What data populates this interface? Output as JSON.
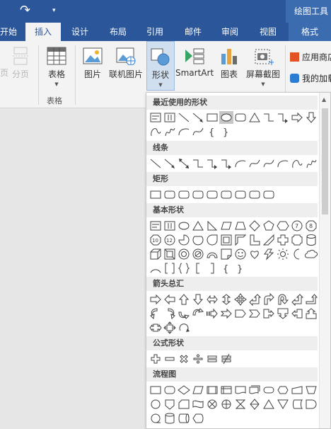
{
  "titlebar": {
    "tool_title": "绘图工具"
  },
  "tabs": [
    {
      "label": "开始",
      "active": false
    },
    {
      "label": "插入",
      "active": true
    },
    {
      "label": "设计",
      "active": false
    },
    {
      "label": "布局",
      "active": false
    },
    {
      "label": "引用",
      "active": false
    },
    {
      "label": "邮件",
      "active": false
    },
    {
      "label": "审阅",
      "active": false
    },
    {
      "label": "视图",
      "active": false
    },
    {
      "label": "格式",
      "active": false
    }
  ],
  "ribbon": {
    "partial_btn": "页",
    "page_break": "分页",
    "table": "表格",
    "table_group": "表格",
    "pictures": "图片",
    "online_pictures": "联机图片",
    "shapes": "形状",
    "smartart": "SmartArt",
    "chart": "图表",
    "screenshot": "屏幕截图",
    "store": "应用商店",
    "my_addins": "我的加载项"
  },
  "dropdown": {
    "sections": [
      {
        "title": "最近使用的形状"
      },
      {
        "title": "线条"
      },
      {
        "title": "矩形"
      },
      {
        "title": "基本形状"
      },
      {
        "title": "箭头总汇"
      },
      {
        "title": "公式形状"
      },
      {
        "title": "流程图"
      }
    ]
  },
  "colors": {
    "accent": "#2b579a",
    "ribbon_bg": "#f3f3f3",
    "selected": "#cfdff0",
    "shape_stroke": "#404040"
  }
}
